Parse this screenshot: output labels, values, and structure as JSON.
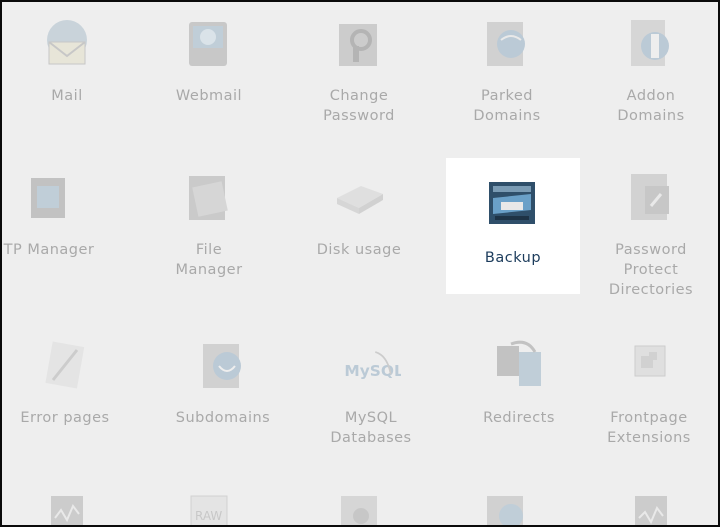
{
  "icons": {
    "mail": "mail-icon",
    "webmail": "webmail-icon",
    "change_password": "change-password-icon",
    "parked_domains": "parked-domains-icon",
    "addon_domains": "addon-domains-icon",
    "ftp_manager": "ftp-manager-icon",
    "file_manager": "file-manager-icon",
    "disk_usage": "disk-usage-icon",
    "backup": "backup-icon",
    "password_protect": "password-protect-icon",
    "error_pages": "error-pages-icon",
    "subdomains": "subdomains-icon",
    "mysql": "mysql-icon",
    "redirects": "redirects-icon",
    "frontpage": "frontpage-extensions-icon"
  },
  "rows": [
    {
      "items": [
        {
          "label": "Mail"
        },
        {
          "label": "Webmail"
        },
        {
          "label": "Change\nPassword"
        },
        {
          "label": "Parked\nDomains"
        },
        {
          "label": "Addon\nDomains"
        }
      ]
    },
    {
      "items": [
        {
          "label": "TP Manager"
        },
        {
          "label": "File\nManager"
        },
        {
          "label": "Disk usage"
        },
        {
          "label": "Backup"
        },
        {
          "label": "Password\nProtect\nDirectories"
        }
      ]
    },
    {
      "items": [
        {
          "label": "Error pages"
        },
        {
          "label": "Subdomains"
        },
        {
          "label": "MySQL\nDatabases"
        },
        {
          "label": "Redirects"
        },
        {
          "label": "Frontpage\nExtensions"
        }
      ]
    }
  ],
  "mysql_logo_text": "MySQL",
  "raw_icon_text": "RAW",
  "colors": {
    "background": "#eeeeee",
    "highlight": "#ffffff",
    "label_inactive": "#a9a9a9",
    "label_active": "#1c3c5c",
    "border": "#0a0a0a"
  }
}
